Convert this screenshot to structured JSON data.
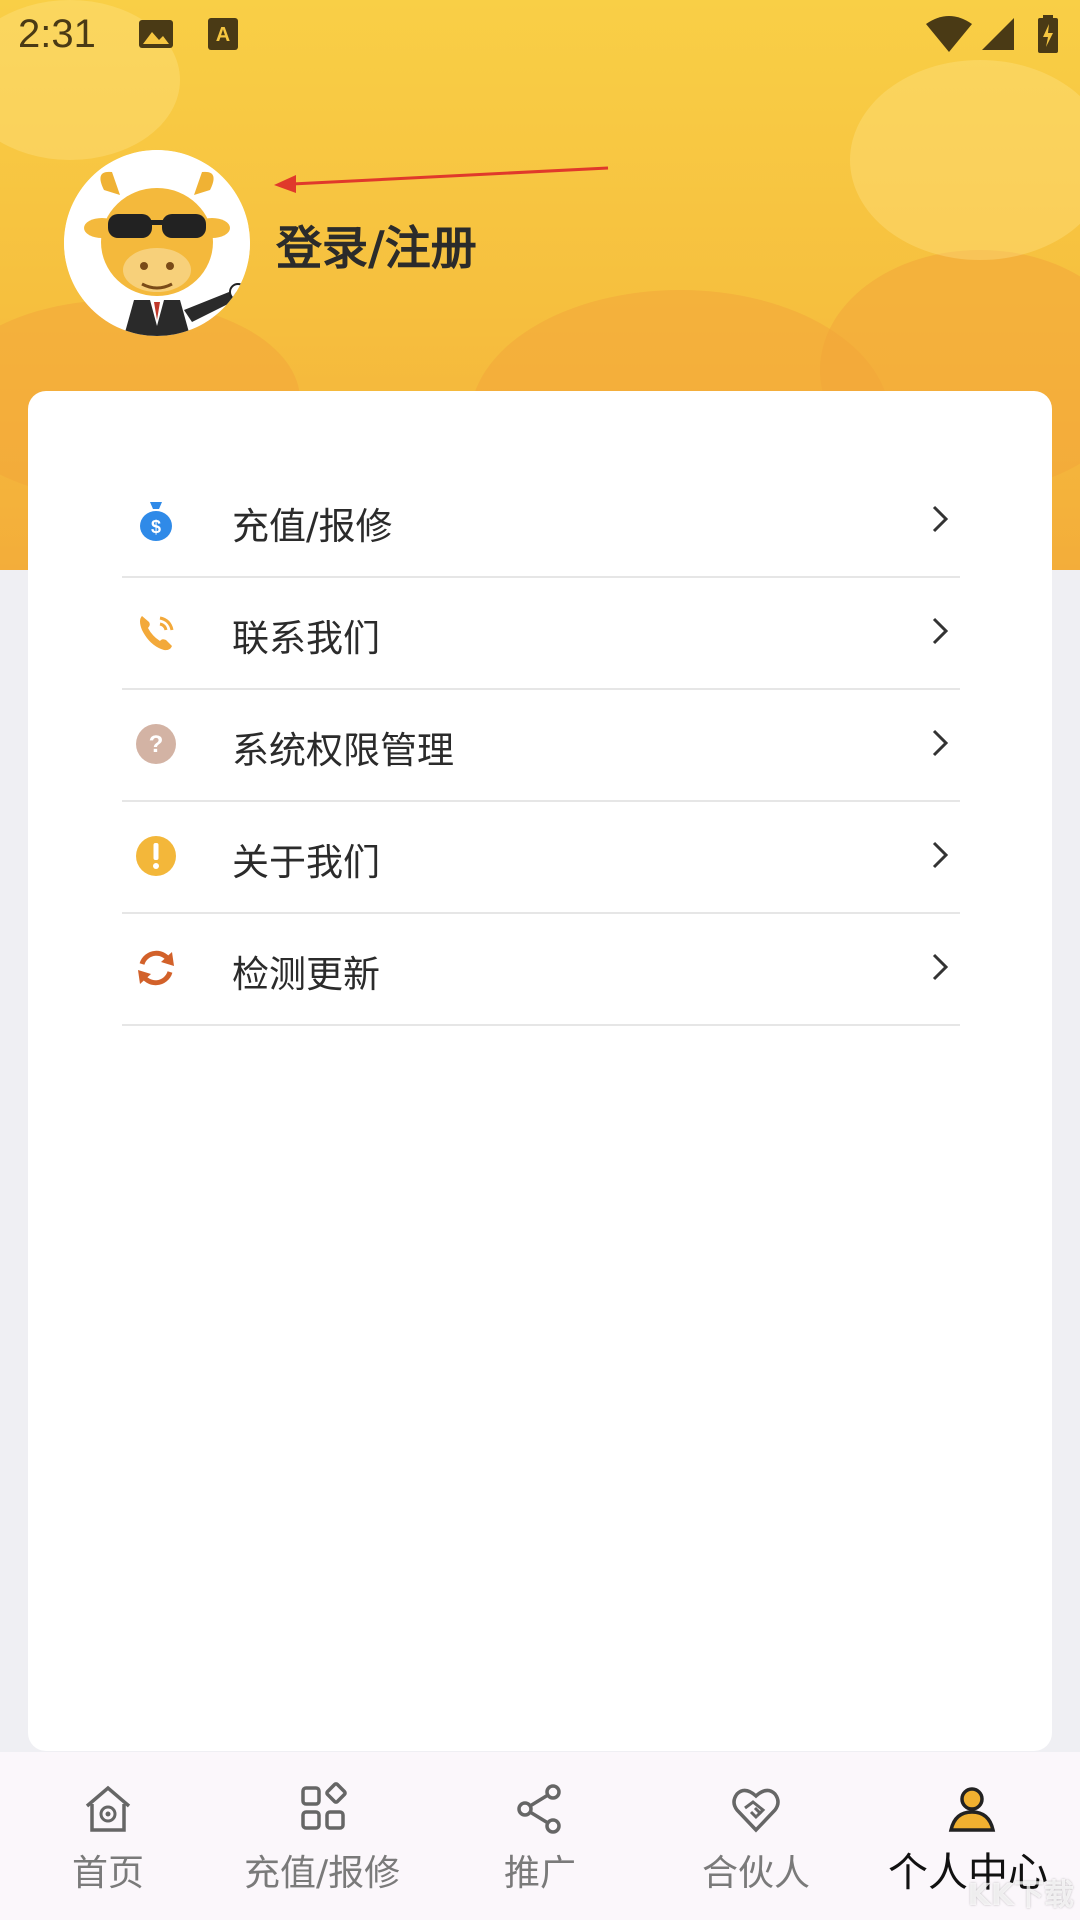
{
  "status_bar": {
    "time": "2:31",
    "icons": [
      "image-icon",
      "keyboard-a-icon",
      "wifi-icon",
      "signal-icon",
      "battery-charging-icon"
    ]
  },
  "profile": {
    "login_label": "登录/注册",
    "avatar": "cow-mascot-avatar"
  },
  "menu": {
    "items": [
      {
        "label": "充值/报修",
        "icon": "money-bag-icon",
        "color": "#2f8ae8"
      },
      {
        "label": "联系我们",
        "icon": "phone-icon",
        "color": "#f3a93a"
      },
      {
        "label": "系统权限管理",
        "icon": "question-icon",
        "color": "#d3b3a4"
      },
      {
        "label": "关于我们",
        "icon": "info-exclamation-icon",
        "color": "#f3b73a"
      },
      {
        "label": "检测更新",
        "icon": "refresh-icon",
        "color": "#d2612a"
      }
    ]
  },
  "tabbar": {
    "tabs": [
      {
        "label": "首页",
        "icon": "home-icon",
        "active": false
      },
      {
        "label": "充值/报修",
        "icon": "apps-icon",
        "active": false
      },
      {
        "label": "推广",
        "icon": "share-icon",
        "active": false
      },
      {
        "label": "合伙人",
        "icon": "handshake-icon",
        "active": false
      },
      {
        "label": "个人中心",
        "icon": "person-icon",
        "active": true
      }
    ],
    "active_color": "#f0b030"
  },
  "watermark": "KK下载"
}
